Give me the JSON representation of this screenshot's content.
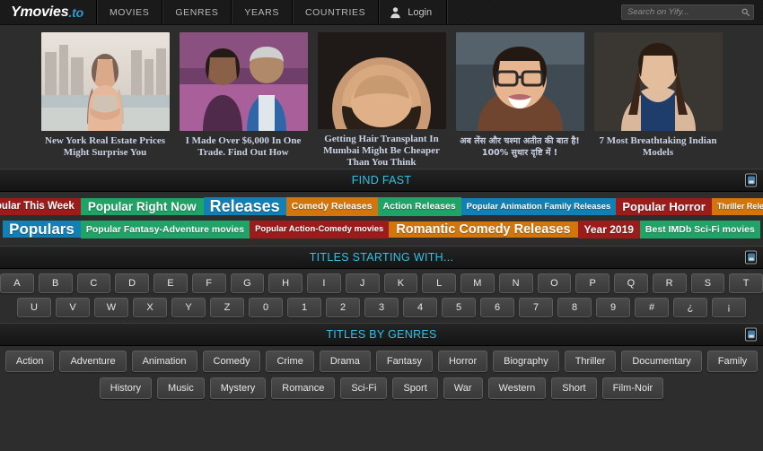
{
  "nav": {
    "brand_name": "Ymovies",
    "brand_suffix": ".to",
    "links": [
      "MOVIES",
      "GENRES",
      "YEARS",
      "COUNTRIES"
    ],
    "login_label": "Login",
    "avatar_icon": "user-icon"
  },
  "search": {
    "placeholder": "Search on Yify...",
    "value": "",
    "icon": "search-icon"
  },
  "ads": [
    {
      "caption": "New York Real Estate Prices Might Surprise You",
      "lang": "en"
    },
    {
      "caption": "I Made Over $6,000 In One Trade. Find Out How",
      "lang": "en"
    },
    {
      "caption": "Getting Hair Transplant In Mumbai Might Be Cheaper Than You Think",
      "lang": "en"
    },
    {
      "caption": "अब लेंस और चश्मा अतीत की बात है! 100% सुधार दृष्टि में !",
      "lang": "hi"
    },
    {
      "caption": "7 Most Breathtaking Indian Models",
      "lang": "en"
    }
  ],
  "sections": {
    "find_fast": {
      "title": "FIND FAST",
      "collapse_icon": "collapse-icon"
    },
    "titles_starting": {
      "title": "TITLES STARTING WITH...",
      "collapse_icon": "collapse-icon"
    },
    "titles_genres": {
      "title": "TITLES BY GENRES",
      "collapse_icon": "collapse-icon"
    }
  },
  "colors": {
    "red": "#9c1c1c",
    "green": "#1fa366",
    "blue": "#1380b5",
    "orange": "#d2750d",
    "accent_cyan": "#2fc3e8",
    "page_bg": "#2d2d2d"
  },
  "find_fast_tags": [
    [
      {
        "label": "Popular This Week",
        "color": "#9c1c1c",
        "size": 11.5
      },
      {
        "label": "Popular Right Now",
        "color": "#1fa366",
        "size": 13.5
      },
      {
        "label": "Releases",
        "color": "#1380b5",
        "size": 18
      },
      {
        "label": "Comedy Releases",
        "color": "#d2750d",
        "size": 10.5
      },
      {
        "label": "Action Releases",
        "color": "#1fa366",
        "size": 10.5
      },
      {
        "label": "Popular Animation Family Releases",
        "color": "#1380b5",
        "size": 9.5
      },
      {
        "label": "Popular Horror",
        "color": "#9c1c1c",
        "size": 13
      },
      {
        "label": "Thriller Releases",
        "color": "#d2750d",
        "size": 9
      }
    ],
    [
      {
        "label": "Populars",
        "color": "#1380b5",
        "size": 17
      },
      {
        "label": "Popular Fantasy-Adventure movies",
        "color": "#1fa366",
        "size": 10.5
      },
      {
        "label": "Popular Action-Comedy movies",
        "color": "#9c1c1c",
        "size": 9.5
      },
      {
        "label": "Romantic Comedy Releases",
        "color": "#d2750d",
        "size": 14.5
      },
      {
        "label": "Year 2019",
        "color": "#9c1c1c",
        "size": 12
      },
      {
        "label": "Best IMDb Sci-Fi movies",
        "color": "#1fa366",
        "size": 10.5
      }
    ]
  ],
  "letters": [
    [
      "A",
      "B",
      "C",
      "D",
      "E",
      "F",
      "G",
      "H",
      "I",
      "J",
      "K",
      "L",
      "M",
      "N",
      "O",
      "P",
      "Q",
      "R",
      "S",
      "T"
    ],
    [
      "U",
      "V",
      "W",
      "X",
      "Y",
      "Z",
      "0",
      "1",
      "2",
      "3",
      "4",
      "5",
      "6",
      "7",
      "8",
      "9",
      "#",
      "¿",
      "¡"
    ]
  ],
  "genres": [
    [
      "Action",
      "Adventure",
      "Animation",
      "Comedy",
      "Crime",
      "Drama",
      "Fantasy",
      "Horror",
      "Biography",
      "Thriller",
      "Documentary",
      "Family"
    ],
    [
      "History",
      "Music",
      "Mystery",
      "Romance",
      "Sci-Fi",
      "Sport",
      "War",
      "Western",
      "Short",
      "Film-Noir"
    ]
  ]
}
